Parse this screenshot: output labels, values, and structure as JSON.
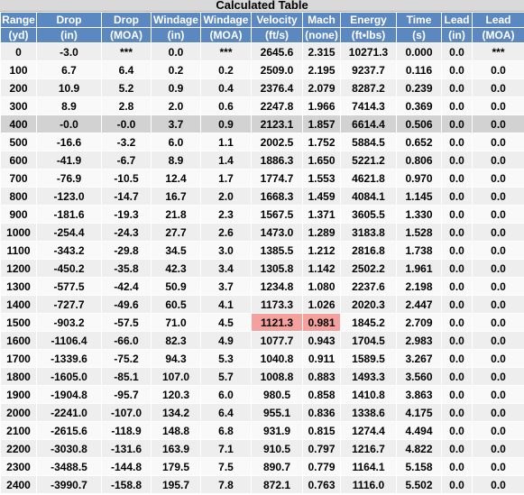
{
  "title": "Calculated Table",
  "colors": {
    "header_bg": "#5b88c0",
    "selected_row": "#d2d2d2",
    "warning_cell": "#f4a09d"
  },
  "selected_row_index": 4,
  "columns": [
    {
      "name": "Range",
      "unit": "(yd)"
    },
    {
      "name": "Drop",
      "unit": "(in)"
    },
    {
      "name": "Drop",
      "unit": "(MOA)"
    },
    {
      "name": "Windage",
      "unit": "(in)"
    },
    {
      "name": "Windage",
      "unit": "(MOA)"
    },
    {
      "name": "Velocity",
      "unit": "(ft/s)"
    },
    {
      "name": "Mach",
      "unit": "(none)"
    },
    {
      "name": "Energy",
      "unit": "(ft•lbs)"
    },
    {
      "name": "Time",
      "unit": "(s)"
    },
    {
      "name": "Lead",
      "unit": "(in)"
    },
    {
      "name": "Lead",
      "unit": "(MOA)"
    }
  ],
  "rows": [
    [
      "0",
      "-3.0",
      "***",
      "0.0",
      "***",
      "2645.6",
      "2.315",
      "10271.3",
      "0.000",
      "0.0",
      "***"
    ],
    [
      "100",
      "6.7",
      "6.4",
      "0.2",
      "0.2",
      "2509.0",
      "2.195",
      "9237.7",
      "0.116",
      "0.0",
      "0.0"
    ],
    [
      "200",
      "10.9",
      "5.2",
      "0.9",
      "0.4",
      "2376.4",
      "2.079",
      "8287.2",
      "0.239",
      "0.0",
      "0.0"
    ],
    [
      "300",
      "8.9",
      "2.8",
      "2.0",
      "0.6",
      "2247.8",
      "1.966",
      "7414.3",
      "0.369",
      "0.0",
      "0.0"
    ],
    [
      "400",
      "-0.0",
      "-0.0",
      "3.7",
      "0.9",
      "2123.1",
      "1.857",
      "6614.4",
      "0.506",
      "0.0",
      "0.0"
    ],
    [
      "500",
      "-16.6",
      "-3.2",
      "6.0",
      "1.1",
      "2002.5",
      "1.752",
      "5884.5",
      "0.652",
      "0.0",
      "0.0"
    ],
    [
      "600",
      "-41.9",
      "-6.7",
      "8.9",
      "1.4",
      "1886.3",
      "1.650",
      "5221.2",
      "0.806",
      "0.0",
      "0.0"
    ],
    [
      "700",
      "-76.9",
      "-10.5",
      "12.4",
      "1.7",
      "1774.7",
      "1.553",
      "4621.8",
      "0.970",
      "0.0",
      "0.0"
    ],
    [
      "800",
      "-123.0",
      "-14.7",
      "16.7",
      "2.0",
      "1668.3",
      "1.459",
      "4084.1",
      "1.145",
      "0.0",
      "0.0"
    ],
    [
      "900",
      "-181.6",
      "-19.3",
      "21.8",
      "2.3",
      "1567.5",
      "1.371",
      "3605.5",
      "1.330",
      "0.0",
      "0.0"
    ],
    [
      "1000",
      "-254.4",
      "-24.3",
      "27.7",
      "2.6",
      "1473.0",
      "1.289",
      "3183.8",
      "1.528",
      "0.0",
      "0.0"
    ],
    [
      "1100",
      "-343.2",
      "-29.8",
      "34.5",
      "3.0",
      "1385.5",
      "1.212",
      "2816.8",
      "1.738",
      "0.0",
      "0.0"
    ],
    [
      "1200",
      "-450.2",
      "-35.8",
      "42.3",
      "3.4",
      "1305.8",
      "1.142",
      "2502.2",
      "1.961",
      "0.0",
      "0.0"
    ],
    [
      "1300",
      "-577.5",
      "-42.4",
      "50.9",
      "3.7",
      "1234.8",
      "1.080",
      "2237.6",
      "2.198",
      "0.0",
      "0.0"
    ],
    [
      "1400",
      "-727.7",
      "-49.6",
      "60.5",
      "4.1",
      "1173.3",
      "1.026",
      "2020.3",
      "2.447",
      "0.0",
      "0.0"
    ],
    [
      "1500",
      "-903.2",
      "-57.5",
      "71.0",
      "4.5",
      "1121.3",
      "0.981",
      "1845.2",
      "2.709",
      "0.0",
      "0.0"
    ],
    [
      "1600",
      "-1106.4",
      "-66.0",
      "82.3",
      "4.9",
      "1077.7",
      "0.943",
      "1704.5",
      "2.983",
      "0.0",
      "0.0"
    ],
    [
      "1700",
      "-1339.6",
      "-75.2",
      "94.3",
      "5.3",
      "1040.8",
      "0.911",
      "1589.5",
      "3.267",
      "0.0",
      "0.0"
    ],
    [
      "1800",
      "-1605.0",
      "-85.1",
      "107.0",
      "5.7",
      "1008.8",
      "0.883",
      "1493.3",
      "3.560",
      "0.0",
      "0.0"
    ],
    [
      "1900",
      "-1904.8",
      "-95.7",
      "120.3",
      "6.0",
      "980.5",
      "0.858",
      "1410.8",
      "3.863",
      "0.0",
      "0.0"
    ],
    [
      "2000",
      "-2241.0",
      "-107.0",
      "134.2",
      "6.4",
      "955.1",
      "0.836",
      "1338.6",
      "4.175",
      "0.0",
      "0.0"
    ],
    [
      "2100",
      "-2615.6",
      "-118.9",
      "148.8",
      "6.8",
      "931.9",
      "0.815",
      "1274.4",
      "4.494",
      "0.0",
      "0.0"
    ],
    [
      "2200",
      "-3030.8",
      "-131.6",
      "163.9",
      "7.1",
      "910.5",
      "0.797",
      "1216.7",
      "4.822",
      "0.0",
      "0.0"
    ],
    [
      "2300",
      "-3488.5",
      "-144.8",
      "179.5",
      "7.5",
      "890.7",
      "0.779",
      "1164.1",
      "5.158",
      "0.0",
      "0.0"
    ],
    [
      "2400",
      "-3990.7",
      "-158.8",
      "195.7",
      "7.8",
      "872.1",
      "0.763",
      "1116.0",
      "5.502",
      "0.0",
      "0.0"
    ]
  ],
  "warning_cells": [
    [
      15,
      5
    ],
    [
      15,
      6
    ]
  ]
}
